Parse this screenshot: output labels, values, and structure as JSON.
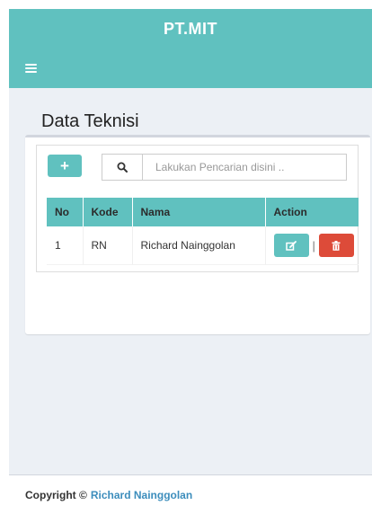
{
  "header": {
    "brand": "PT.MIT"
  },
  "page": {
    "title": "Data Teknisi"
  },
  "search": {
    "placeholder": "Lakukan Pencarian disini .."
  },
  "table": {
    "columns": [
      "No",
      "Kode",
      "Nama",
      "Action"
    ],
    "rows": [
      {
        "no": "1",
        "kode": "RN",
        "nama": "Richard Nainggolan",
        "separator": "|"
      }
    ]
  },
  "footer": {
    "copyright_label": "Copyright ©",
    "author_link": "Richard Nainggolan"
  },
  "colors": {
    "accent": "#60c1bf",
    "danger": "#dd4b39",
    "link": "#3c8dbc",
    "background": "#ecf0f5"
  },
  "icons": {
    "menu": "hamburger-menu-icon",
    "add": "plus-icon",
    "search": "search-icon",
    "edit": "edit-icon",
    "delete": "trash-icon"
  }
}
